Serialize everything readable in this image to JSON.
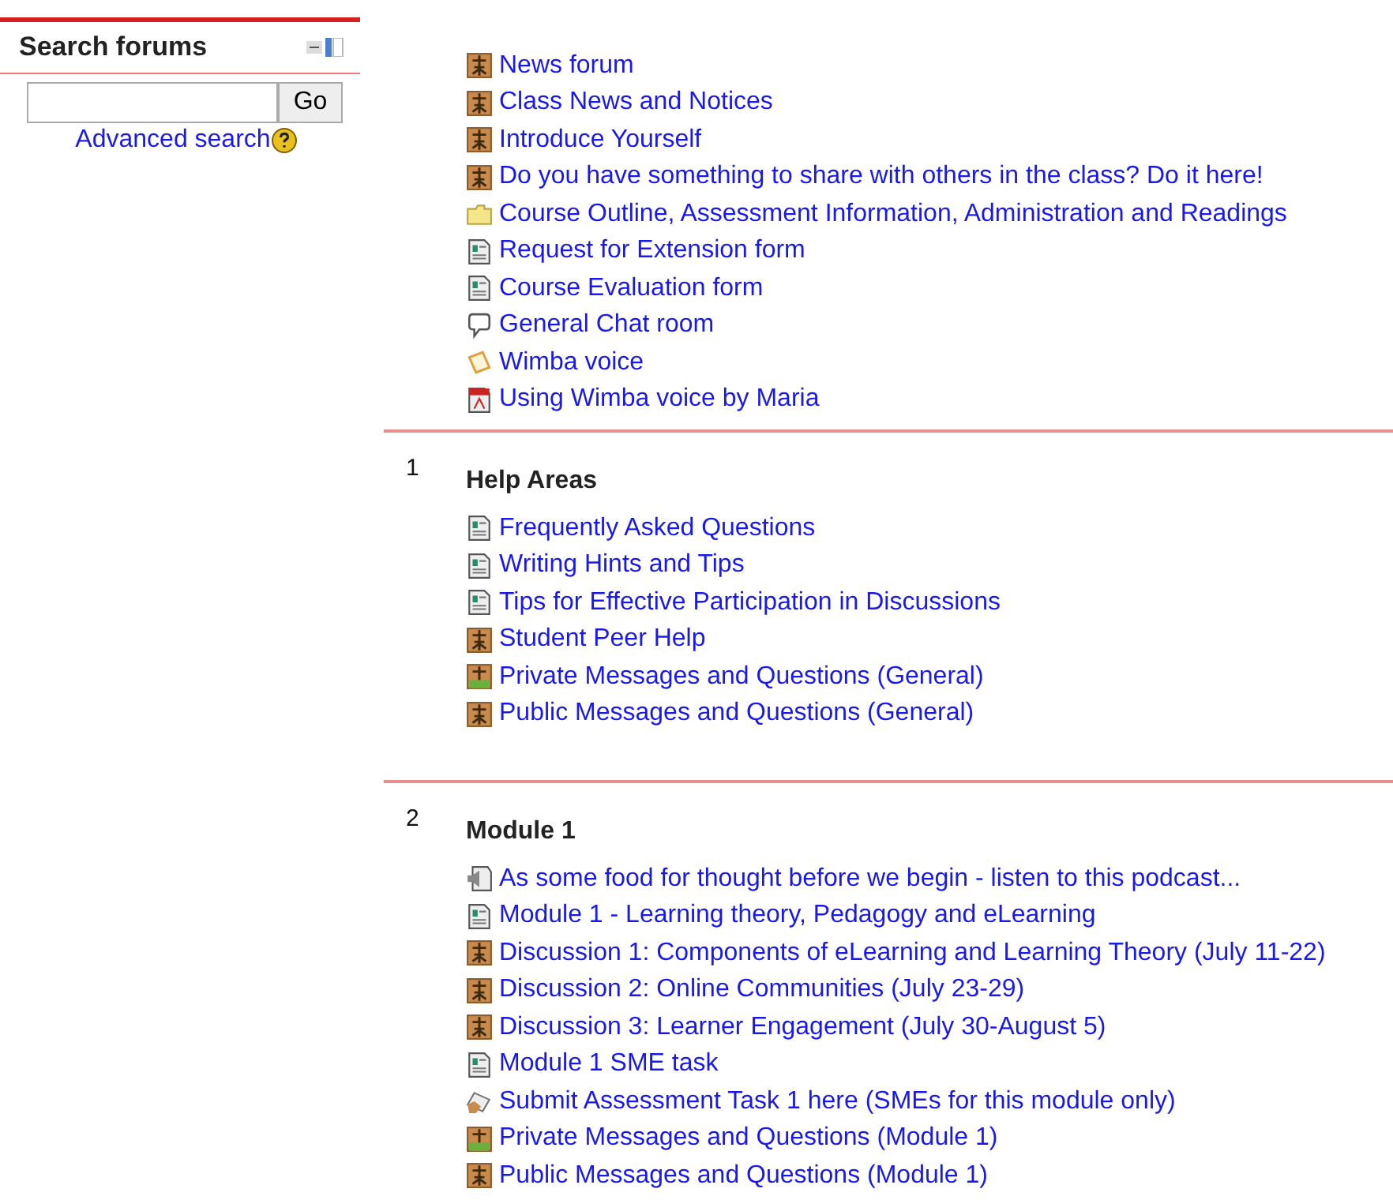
{
  "sidebar": {
    "title": "Search forums",
    "search": {
      "button": "Go"
    },
    "advanced_link": "Advanced search"
  },
  "sections": [
    {
      "items": [
        {
          "kind": "forum",
          "label": "News forum"
        },
        {
          "kind": "forum",
          "label": "Class News and Notices"
        },
        {
          "kind": "forum",
          "label": "Introduce Yourself"
        },
        {
          "kind": "forum",
          "label": "Do you have something to share with others in the class? Do it here!"
        },
        {
          "kind": "folder",
          "label": "Course Outline, Assessment Information, Administration and Readings"
        },
        {
          "kind": "page",
          "label": "Request for Extension form"
        },
        {
          "kind": "page",
          "label": "Course Evaluation form"
        },
        {
          "kind": "chat",
          "label": "General Chat room"
        },
        {
          "kind": "wimba",
          "label": "Wimba voice"
        },
        {
          "kind": "pdf",
          "label": "Using Wimba voice by Maria"
        }
      ]
    },
    {
      "number": "1",
      "title": "Help Areas",
      "items": [
        {
          "kind": "page",
          "label": "Frequently Asked Questions"
        },
        {
          "kind": "page",
          "label": "Writing Hints and Tips"
        },
        {
          "kind": "page",
          "label": "Tips for Effective Participation in Discussions"
        },
        {
          "kind": "forum",
          "label": "Student Peer Help"
        },
        {
          "kind": "private",
          "label": "Private Messages and Questions (General)"
        },
        {
          "kind": "forum",
          "label": "Public Messages and Questions (General)"
        }
      ]
    },
    {
      "number": "2",
      "title": "Module 1",
      "items": [
        {
          "kind": "audio",
          "label": "As some food for thought before we begin - listen to this podcast..."
        },
        {
          "kind": "page",
          "label": "Module 1 - Learning theory, Pedagogy and eLearning"
        },
        {
          "kind": "forum",
          "label": "Discussion 1: Components of eLearning and Learning Theory (July 11-22)"
        },
        {
          "kind": "forum",
          "label": "Discussion 2: Online Communities (July 23-29)"
        },
        {
          "kind": "forum",
          "label": "Discussion 3: Learner Engagement (July 30-August 5)"
        },
        {
          "kind": "page",
          "label": "Module 1 SME task"
        },
        {
          "kind": "assignment",
          "label": "Submit Assessment Task 1 here (SMEs for this module only)"
        },
        {
          "kind": "private",
          "label": "Private Messages and Questions (Module 1)"
        },
        {
          "kind": "forum",
          "label": "Public Messages and Questions (Module 1)"
        }
      ]
    }
  ]
}
